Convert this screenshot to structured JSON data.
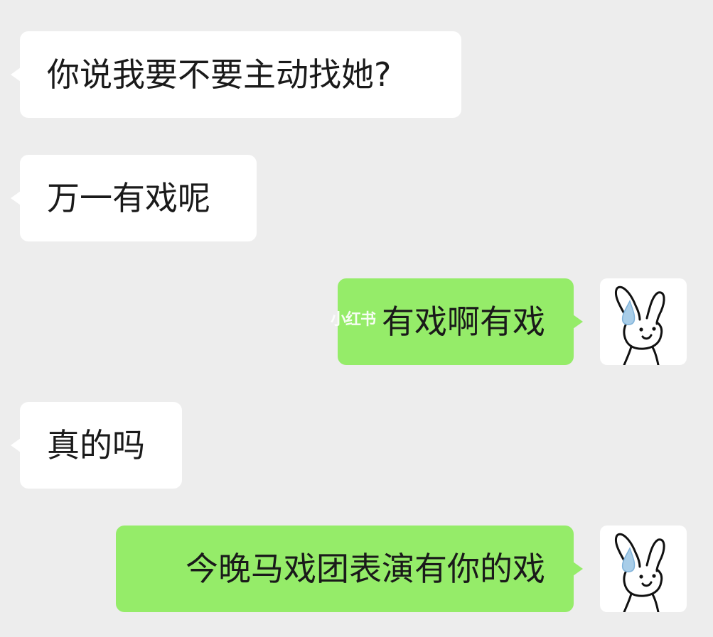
{
  "chat": {
    "messages": [
      {
        "id": "m1",
        "side": "received",
        "text": "你说我要不要主动找她?"
      },
      {
        "id": "m2",
        "side": "received",
        "text": "万一有戏呢"
      },
      {
        "id": "m3",
        "side": "sent",
        "text": "有戏啊有戏",
        "avatar": "rabbit-sweat-avatar"
      },
      {
        "id": "m4",
        "side": "received",
        "text": "真的吗"
      },
      {
        "id": "m5",
        "side": "sent",
        "text": "今晚马戏团表演有你的戏",
        "avatar": "rabbit-sweat-avatar"
      }
    ]
  },
  "watermark": {
    "text": "小红书"
  },
  "colors": {
    "background": "#ededed",
    "received_bubble": "#ffffff",
    "sent_bubble": "#95ec69",
    "text": "#1a1a1a",
    "sweat_drop": "#a8cde8"
  }
}
